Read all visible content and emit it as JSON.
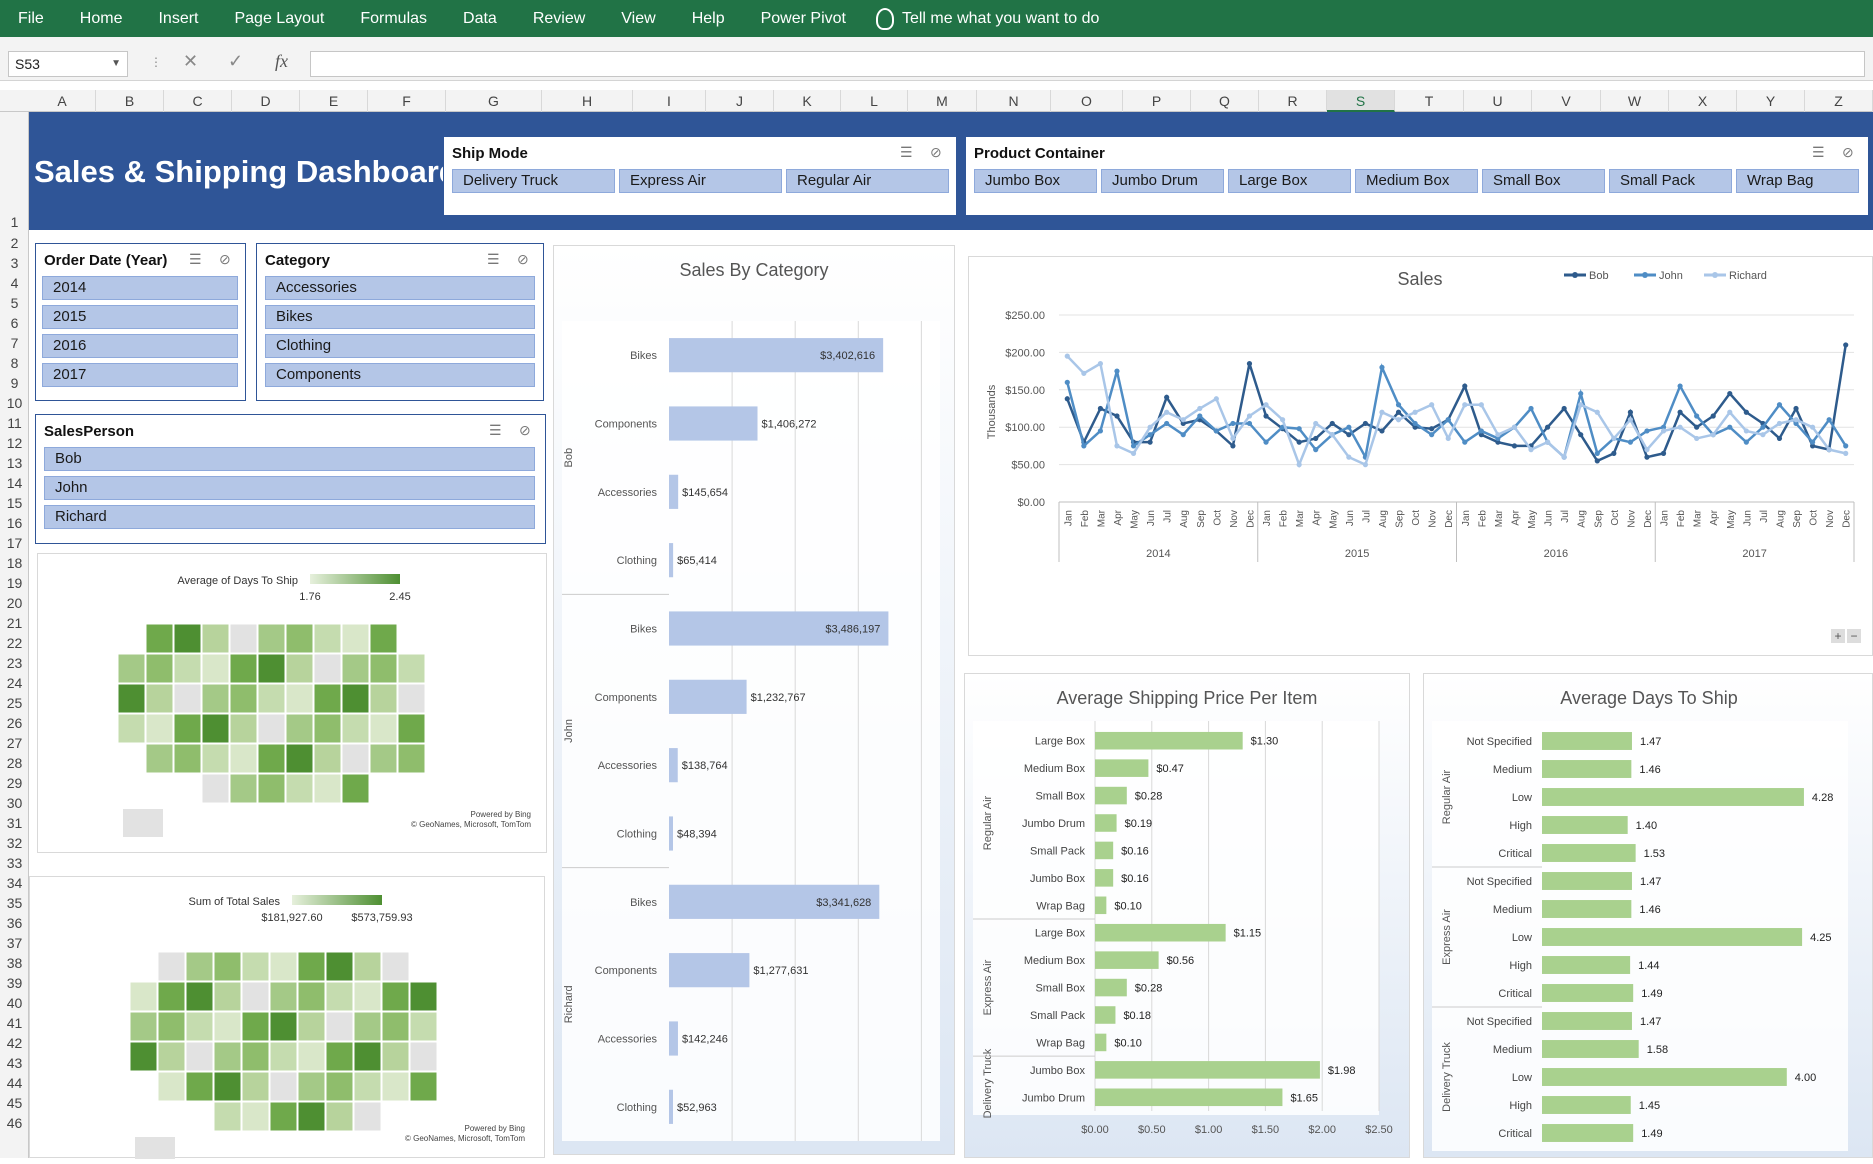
{
  "ribbon": {
    "tabs": [
      "File",
      "Home",
      "Insert",
      "Page Layout",
      "Formulas",
      "Data",
      "Review",
      "View",
      "Help",
      "Power Pivot"
    ],
    "tell_me": "Tell me what you want to do"
  },
  "formula_bar": {
    "name_box": "S53",
    "fx_label": "fx",
    "formula": ""
  },
  "columns": [
    "A",
    "B",
    "C",
    "D",
    "E",
    "F",
    "G",
    "H",
    "I",
    "J",
    "K",
    "L",
    "M",
    "N",
    "O",
    "P",
    "Q",
    "R",
    "S",
    "T",
    "U",
    "V",
    "W",
    "X",
    "Y",
    "Z"
  ],
  "selected_column": "S",
  "rows": [
    "1",
    "2",
    "3",
    "4",
    "5",
    "6",
    "7",
    "8",
    "9",
    "10",
    "11",
    "12",
    "13",
    "14",
    "15",
    "16",
    "17",
    "18",
    "19",
    "20",
    "21",
    "22",
    "23",
    "24",
    "25",
    "26",
    "27",
    "28",
    "29",
    "30",
    "31",
    "32",
    "33",
    "34",
    "35",
    "36",
    "37",
    "38",
    "39",
    "40",
    "41",
    "42",
    "43",
    "44",
    "45",
    "46"
  ],
  "dashboard_title": "Sales & Shipping Dashboard",
  "slicers": {
    "ship_mode": {
      "title": "Ship Mode",
      "items": [
        "Delivery Truck",
        "Express Air",
        "Regular Air"
      ]
    },
    "product_container": {
      "title": "Product Container",
      "items": [
        "Jumbo Box",
        "Jumbo Drum",
        "Large Box",
        "Medium Box",
        "Small Box",
        "Small Pack",
        "Wrap Bag"
      ]
    },
    "order_date": {
      "title": "Order Date (Year)",
      "items": [
        "2014",
        "2015",
        "2016",
        "2017"
      ]
    },
    "category": {
      "title": "Category",
      "items": [
        "Accessories",
        "Bikes",
        "Clothing",
        "Components"
      ]
    },
    "salesperson": {
      "title": "SalesPerson",
      "items": [
        "Bob",
        "John",
        "Richard"
      ]
    }
  },
  "maps": [
    {
      "legend_title": "Average of Days To Ship",
      "min": "1.76",
      "max": "2.45",
      "credit1": "Powered by Bing",
      "credit2": "© GeoNames, Microsoft, TomTom"
    },
    {
      "legend_title": "Sum of Total Sales",
      "min": "$181,927.60",
      "max": "$573,759.93",
      "credit1": "Powered by Bing",
      "credit2": "© GeoNames, Microsoft, TomTom"
    }
  ],
  "colors": {
    "ribbon": "#217346",
    "banner": "#2f5597",
    "slicer_button": "#b4c6e7",
    "bar_blue": "#b4c6e7",
    "bar_green": "#a9d18e",
    "bob": "#2e5b8c",
    "john": "#4f8dc5",
    "richard": "#a9c6e8"
  },
  "chart_data": [
    {
      "type": "bar",
      "title": "Sales By Category",
      "groups": [
        "Bob",
        "John",
        "Richard"
      ],
      "categories": [
        "Bikes",
        "Components",
        "Accessories",
        "Clothing",
        "Bikes",
        "Components",
        "Accessories",
        "Clothing",
        "Bikes",
        "Components",
        "Accessories",
        "Clothing"
      ],
      "values": [
        3402616,
        1406272,
        145654,
        65414,
        3486197,
        1232767,
        138764,
        48394,
        3341628,
        1277631,
        142246,
        52963
      ],
      "labels": [
        "$3,402,616",
        "$1,406,272",
        "$145,654",
        "$65,414",
        "$3,486,197",
        "$1,232,767",
        "$138,764",
        "$48,394",
        "$3,341,628",
        "$1,277,631",
        "$142,246",
        "$52,963"
      ]
    },
    {
      "type": "line",
      "title": "Sales",
      "ylabel": "Thousands",
      "ylim": [
        0,
        250
      ],
      "y_ticks": [
        "$0.00",
        "$50.00",
        "$100.00",
        "$150.00",
        "$200.00",
        "$250.00"
      ],
      "months": [
        "Jan",
        "Feb",
        "Mar",
        "Apr",
        "May",
        "Jun",
        "Jul",
        "Aug",
        "Sep",
        "Oct",
        "Nov",
        "Dec"
      ],
      "years": [
        "2014",
        "2015",
        "2016",
        "2017"
      ],
      "series": [
        {
          "name": "Bob",
          "values": [
            138,
            80,
            125,
            115,
            80,
            80,
            140,
            105,
            110,
            95,
            75,
            185,
            115,
            98,
            80,
            85,
            105,
            90,
            105,
            95,
            120,
            100,
            98,
            110,
            155,
            90,
            80,
            75,
            75,
            100,
            125,
            90,
            55,
            65,
            120,
            60,
            65,
            120,
            100,
            115,
            145,
            120,
            105,
            85,
            125,
            75,
            70,
            210
          ]
        },
        {
          "name": "John",
          "values": [
            160,
            75,
            95,
            175,
            75,
            90,
            105,
            90,
            115,
            95,
            105,
            105,
            80,
            100,
            98,
            70,
            90,
            100,
            60,
            180,
            130,
            105,
            90,
            110,
            80,
            95,
            85,
            100,
            125,
            80,
            60,
            145,
            65,
            85,
            80,
            95,
            100,
            155,
            115,
            90,
            100,
            80,
            100,
            130,
            105,
            80,
            110,
            75
          ]
        },
        {
          "name": "Richard",
          "values": [
            195,
            172,
            185,
            75,
            65,
            100,
            120,
            110,
            125,
            138,
            85,
            115,
            130,
            110,
            50,
            105,
            90,
            60,
            50,
            120,
            110,
            120,
            130,
            85,
            130,
            130,
            90,
            100,
            70,
            80,
            60,
            130,
            120,
            85,
            110,
            70,
            95,
            100,
            85,
            90,
            120,
            95,
            90,
            105,
            110,
            100,
            70,
            65
          ]
        }
      ]
    },
    {
      "type": "bar",
      "title": "Average Shipping Price Per Item",
      "xlim": [
        0,
        2.5
      ],
      "x_ticks": [
        "$0.00",
        "$0.50",
        "$1.00",
        "$1.50",
        "$2.00",
        "$2.50"
      ],
      "groups": [
        {
          "name": "Regular Air",
          "categories": [
            "Large Box",
            "Medium Box",
            "Small Box",
            "Jumbo Drum",
            "Small Pack",
            "Jumbo Box",
            "Wrap Bag"
          ],
          "values": [
            1.3,
            0.47,
            0.28,
            0.19,
            0.16,
            0.16,
            0.1
          ],
          "labels": [
            "$1.30",
            "$0.47",
            "$0.28",
            "$0.19",
            "$0.16",
            "$0.16",
            "$0.10"
          ]
        },
        {
          "name": "Express Air",
          "categories": [
            "Large Box",
            "Medium Box",
            "Small Box",
            "Small Pack",
            "Wrap Bag"
          ],
          "values": [
            1.15,
            0.56,
            0.28,
            0.18,
            0.1
          ],
          "labels": [
            "$1.15",
            "$0.56",
            "$0.28",
            "$0.18",
            "$0.10"
          ]
        },
        {
          "name": "Delivery Truck",
          "categories": [
            "Jumbo Box",
            "Jumbo Drum"
          ],
          "values": [
            1.98,
            1.65
          ],
          "labels": [
            "$1.98",
            "$1.65"
          ]
        }
      ]
    },
    {
      "type": "bar",
      "title": "Average Days To Ship",
      "xlim": [
        0,
        5
      ],
      "groups": [
        {
          "name": "Regular Air",
          "categories": [
            "Not Specified",
            "Medium",
            "Low",
            "High",
            "Critical"
          ],
          "values": [
            1.47,
            1.46,
            4.28,
            1.4,
            1.53
          ],
          "labels": [
            "1.47",
            "1.46",
            "4.28",
            "1.40",
            "1.53"
          ]
        },
        {
          "name": "Express Air",
          "categories": [
            "Not Specified",
            "Medium",
            "Low",
            "High",
            "Critical"
          ],
          "values": [
            1.47,
            1.46,
            4.25,
            1.44,
            1.49
          ],
          "labels": [
            "1.47",
            "1.46",
            "4.25",
            "1.44",
            "1.49"
          ]
        },
        {
          "name": "Delivery Truck",
          "categories": [
            "Not Specified",
            "Medium",
            "Low",
            "High",
            "Critical"
          ],
          "values": [
            1.47,
            1.58,
            4.0,
            1.45,
            1.49
          ],
          "labels": [
            "1.47",
            "1.58",
            "4.00",
            "1.45",
            "1.49"
          ]
        }
      ]
    }
  ]
}
